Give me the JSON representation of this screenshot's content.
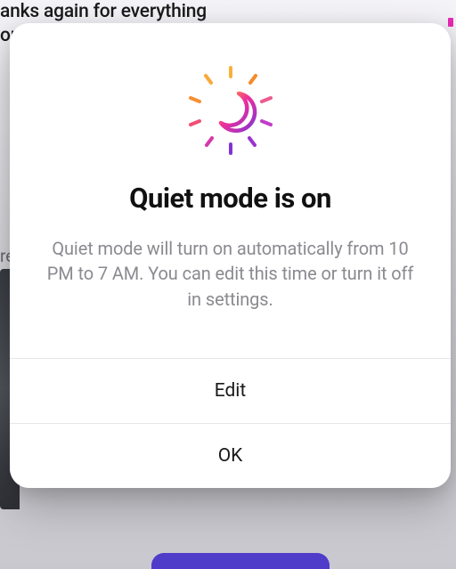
{
  "background": {
    "partial_top_text": "anks again for everything\nou",
    "partial_left_text": "re"
  },
  "dialog": {
    "title": "Quiet mode is on",
    "description": "Quiet mode will turn on automatically from 10 PM to 7 AM. You can edit this time or turn it off in settings.",
    "edit_label": "Edit",
    "ok_label": "OK"
  },
  "icon": {
    "name": "quiet-mode-moon-icon",
    "gradient_start": "#f9a825",
    "gradient_mid": "#f02f9a",
    "gradient_end": "#8134d6"
  }
}
